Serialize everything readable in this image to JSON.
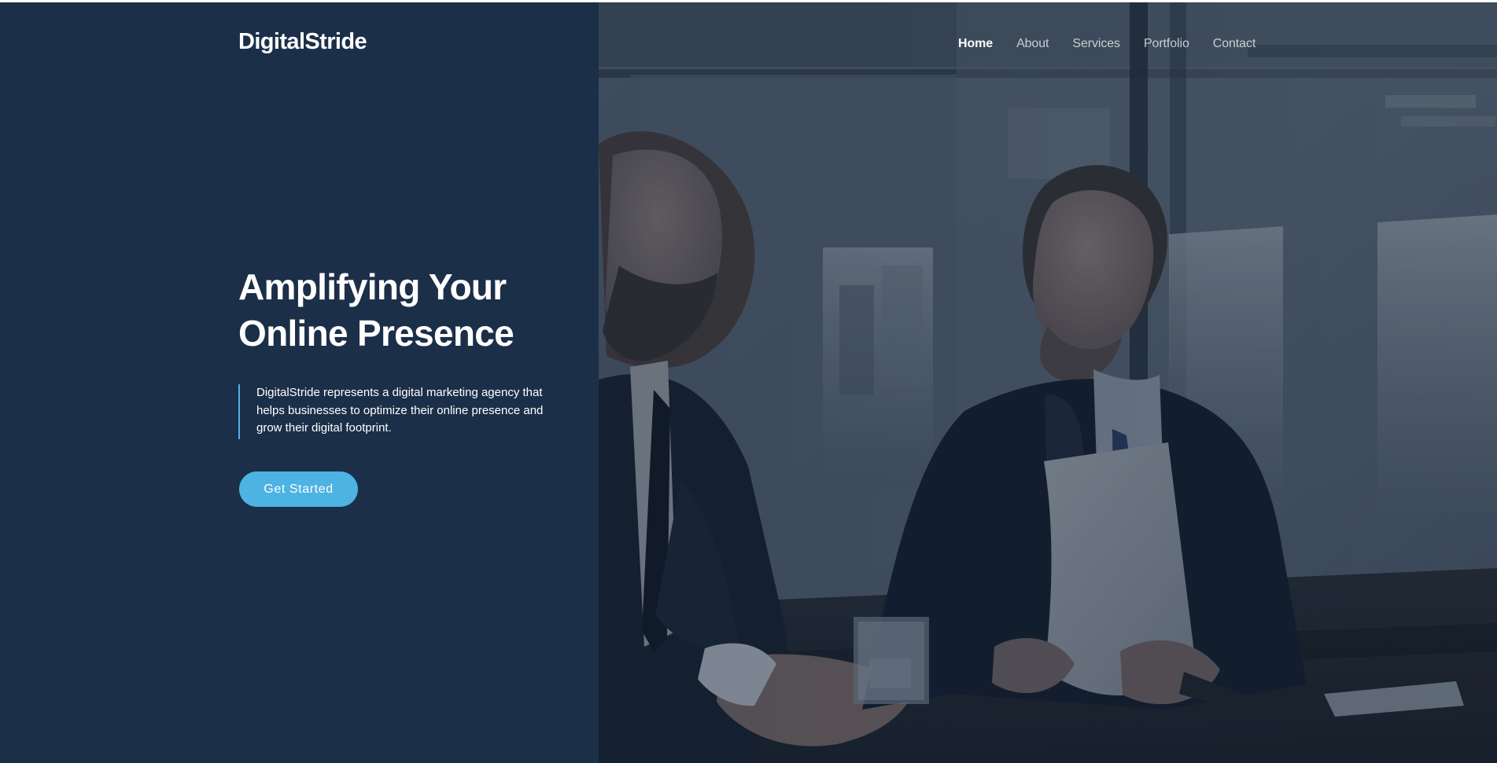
{
  "header": {
    "logo_text": "DigitalStride",
    "nav": [
      {
        "label": "Home",
        "active": true
      },
      {
        "label": "About",
        "active": false
      },
      {
        "label": "Services",
        "active": false
      },
      {
        "label": "Portfolio",
        "active": false
      },
      {
        "label": "Contact",
        "active": false
      }
    ]
  },
  "hero": {
    "title_lines": [
      "Amplifying Your",
      "Online Presence"
    ],
    "description": "DigitalStride represents a digital marketing agency that helps businesses to optimize their online presence and grow their digital footprint.",
    "cta_label": "Get Started",
    "image_subject": "two-businessmen-meeting-photo"
  },
  "colors": {
    "left_panel": "#1c2f48",
    "accent": "#4db3e3",
    "text": "#ffffff",
    "nav_inactive": "rgba(255,255,255,0.72)",
    "photo_overlay": "#1c2f48"
  }
}
